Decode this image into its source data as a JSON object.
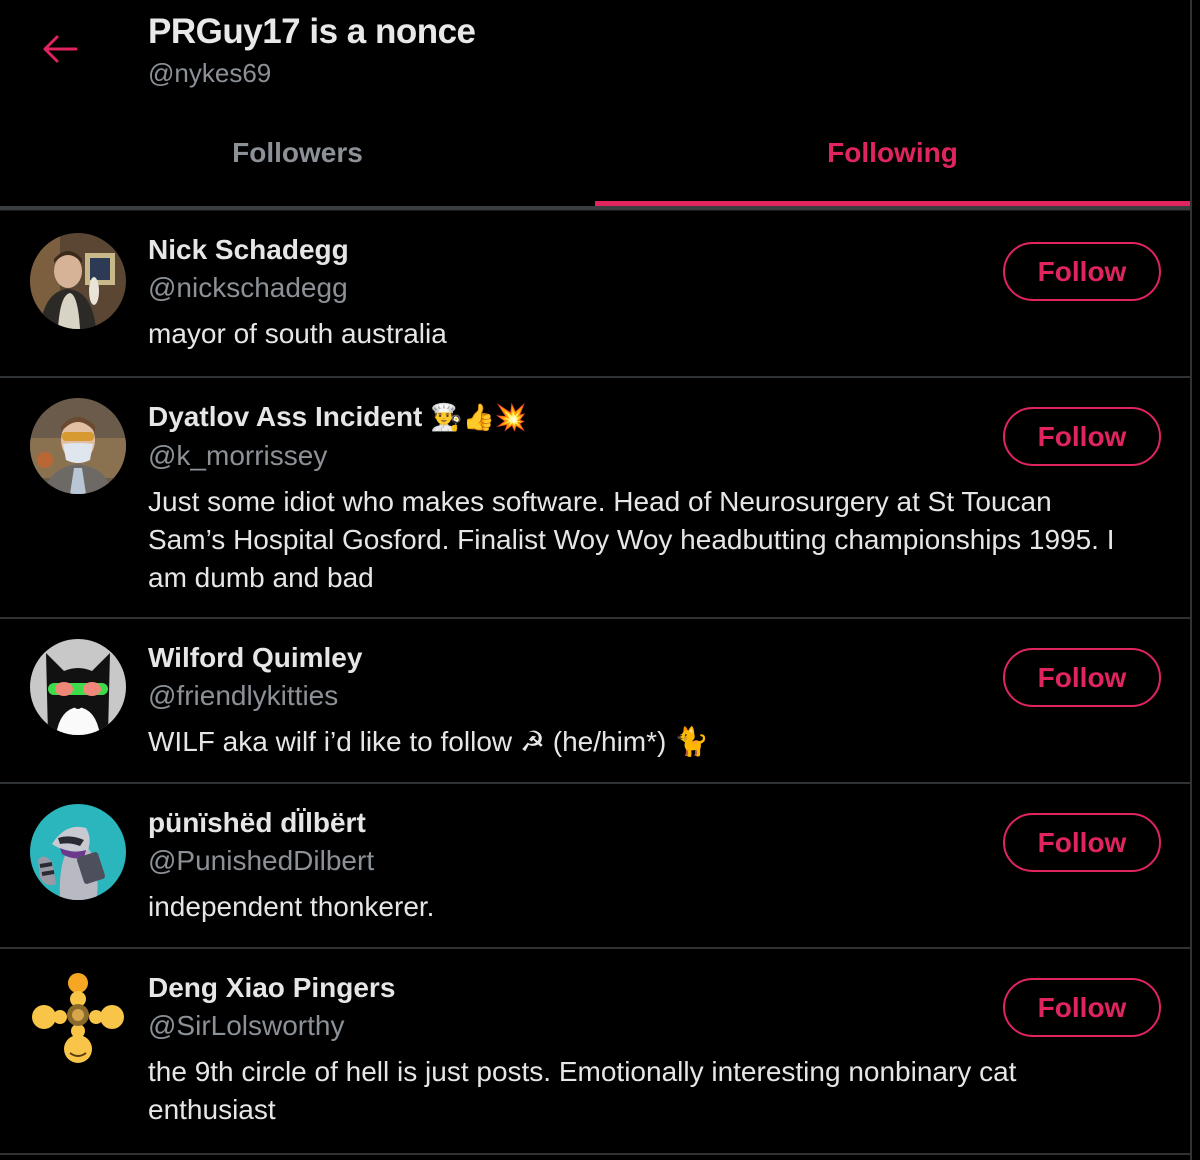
{
  "header": {
    "back_icon": "arrow-left-icon",
    "title": "PRGuy17 is a nonce",
    "handle": "@nykes69"
  },
  "tabs": [
    {
      "label": "Followers",
      "active": false
    },
    {
      "label": "Following",
      "active": true
    }
  ],
  "colors": {
    "accent": "#e0245e",
    "background": "#000000",
    "secondary_text": "#8b9197",
    "primary_text": "#e6e6e6",
    "divider": "#2f3336"
  },
  "users": [
    {
      "name": "Nick Schadegg",
      "name_emoji": "",
      "handle": "@nickschadegg",
      "bio": "mayor of south australia",
      "follow_label": "Follow"
    },
    {
      "name": "Dyatlov Ass Incident",
      "name_emoji": "👨‍🍳👍💥",
      "handle": "@k_morrissey",
      "bio": "Just some idiot who makes software. Head of Neurosurgery at St Toucan Sam’s Hospital Gosford. Finalist Woy Woy headbutting championships 1995. I am dumb and bad",
      "follow_label": "Follow"
    },
    {
      "name": "Wilford Quimley",
      "name_emoji": "",
      "handle": "@friendlykitties",
      "bio": "WILF aka wilf i’d like to follow ☭ (he/him*) 🐈",
      "follow_label": "Follow"
    },
    {
      "name": "pünïshëd dÏlbërt",
      "name_emoji": "",
      "handle": "@PunishedDilbert",
      "bio": "independent thonkerer.",
      "follow_label": "Follow"
    },
    {
      "name": "Deng Xiao Pingers",
      "name_emoji": "",
      "handle": "@SirLolsworthy",
      "bio": "the 9th circle of hell is just posts. Emotionally interesting nonbinary cat enthusiast",
      "follow_label": "Follow"
    }
  ]
}
